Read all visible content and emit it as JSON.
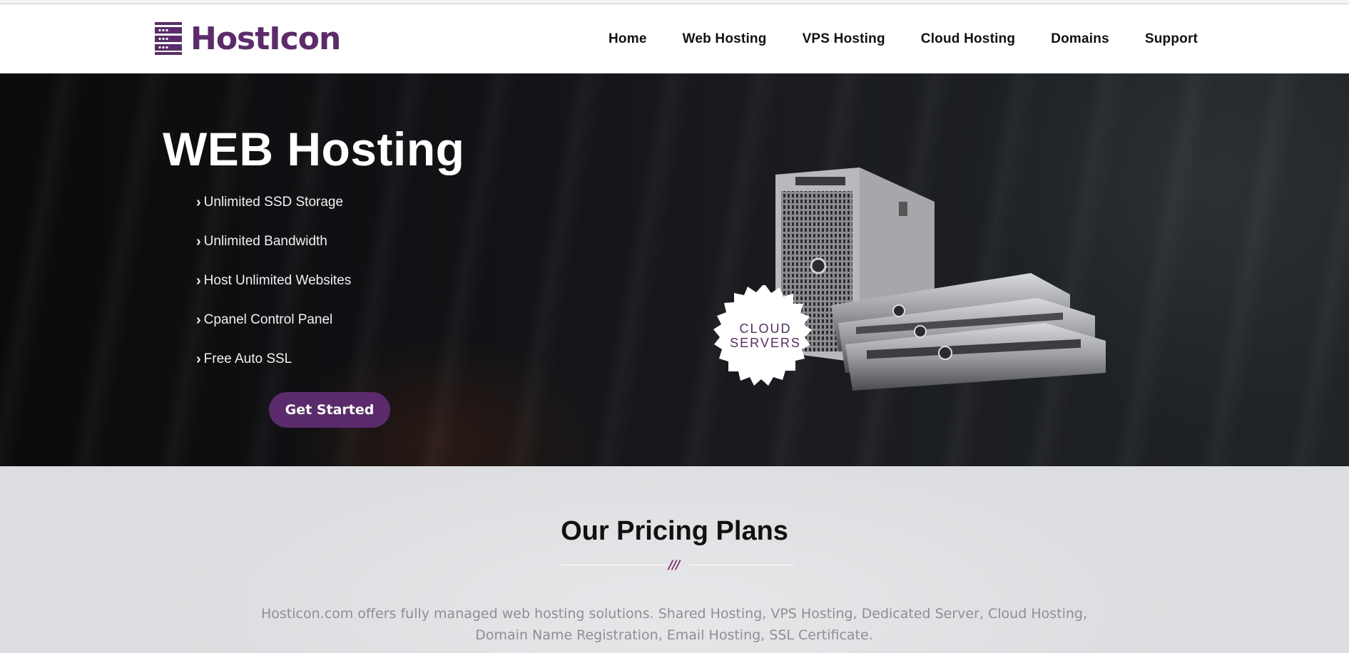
{
  "brand": {
    "name": "HostIcon",
    "accent": "#5a2a6d"
  },
  "nav": {
    "items": [
      {
        "label": "Home"
      },
      {
        "label": "Web Hosting"
      },
      {
        "label": "VPS Hosting"
      },
      {
        "label": "Cloud Hosting"
      },
      {
        "label": "Domains"
      },
      {
        "label": "Support"
      }
    ]
  },
  "hero": {
    "title": "WEB Hosting",
    "features": [
      "Unlimited SSD Storage",
      "Unlimited Bandwidth",
      "Host Unlimited Websites",
      "Cpanel Control Panel",
      "Free Auto SSL"
    ],
    "cta_label": "Get Started",
    "badge_line1": "CLOUD",
    "badge_line2": "SERVERS"
  },
  "pricing": {
    "title": "Our Pricing Plans",
    "divider_mark": "///",
    "description_line1": "Hosticon.com offers fully managed web hosting solutions. Shared Hosting, VPS Hosting, Dedicated Server, Cloud Hosting,",
    "description_line2": "Domain Name Registration, Email Hosting, SSL Certificate."
  }
}
